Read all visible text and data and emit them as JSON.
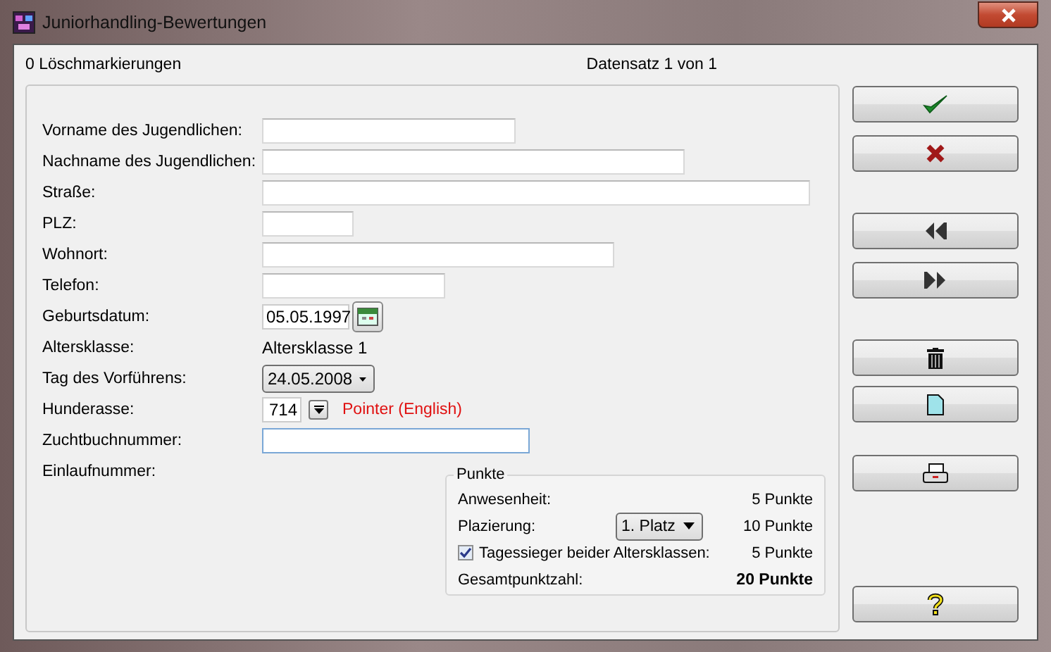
{
  "window": {
    "title": "Juniorhandling-Bewertungen"
  },
  "header": {
    "deletion_marks": "0 Löschmarkierungen",
    "record": "Datensatz 1 von 1"
  },
  "fields": [
    {
      "kind": "text",
      "label": "Vorname des Jugendlichen:",
      "focused": false
    },
    {
      "kind": "text",
      "label": "Nachname des Jugendlichen:",
      "focused": false
    },
    {
      "kind": "text",
      "label": "Straße:",
      "focused": false
    },
    {
      "kind": "text",
      "label": "PLZ:",
      "focused": false
    },
    {
      "kind": "text",
      "label": "Wohnort:",
      "focused": false
    },
    {
      "kind": "text",
      "label": "Telefon:",
      "focused": false
    },
    {
      "kind": "date",
      "label": "Geburtsdatum:",
      "value": "05.05.1997"
    },
    {
      "kind": "static",
      "label": "Altersklasse:",
      "value": "Altersklasse 1"
    },
    {
      "kind": "select",
      "label": "Tag des Vorführens:",
      "value": "24.05.2008"
    },
    {
      "kind": "breed",
      "label": "Hunderasse:",
      "value": "714",
      "breed_name": "Pointer (English)"
    },
    {
      "kind": "text",
      "label": "Zuchtbuchnummer:",
      "focused": true
    },
    {
      "kind": "none",
      "label": "Einlaufnummer:"
    }
  ],
  "points": {
    "title": "Punkte",
    "rows": [
      {
        "kind": "plain",
        "label": "Anwesenheit:",
        "points": "5 Punkte"
      },
      {
        "kind": "select",
        "label": "Plazierung:",
        "value": "1. Platz",
        "points": "10 Punkte"
      },
      {
        "kind": "check",
        "label": "Tagessieger beider Altersklassen:",
        "checked": true,
        "points": "5 Punkte"
      },
      {
        "kind": "total",
        "label": "Gesamtpunktzahl:",
        "points": "20 Punkte"
      }
    ]
  },
  "buttons": [
    {
      "kind": "save"
    },
    {
      "kind": "cancel"
    },
    {
      "kind": "first"
    },
    {
      "kind": "last"
    },
    {
      "kind": "delete"
    },
    {
      "kind": "new"
    },
    {
      "kind": "print"
    },
    {
      "kind": "help"
    }
  ]
}
